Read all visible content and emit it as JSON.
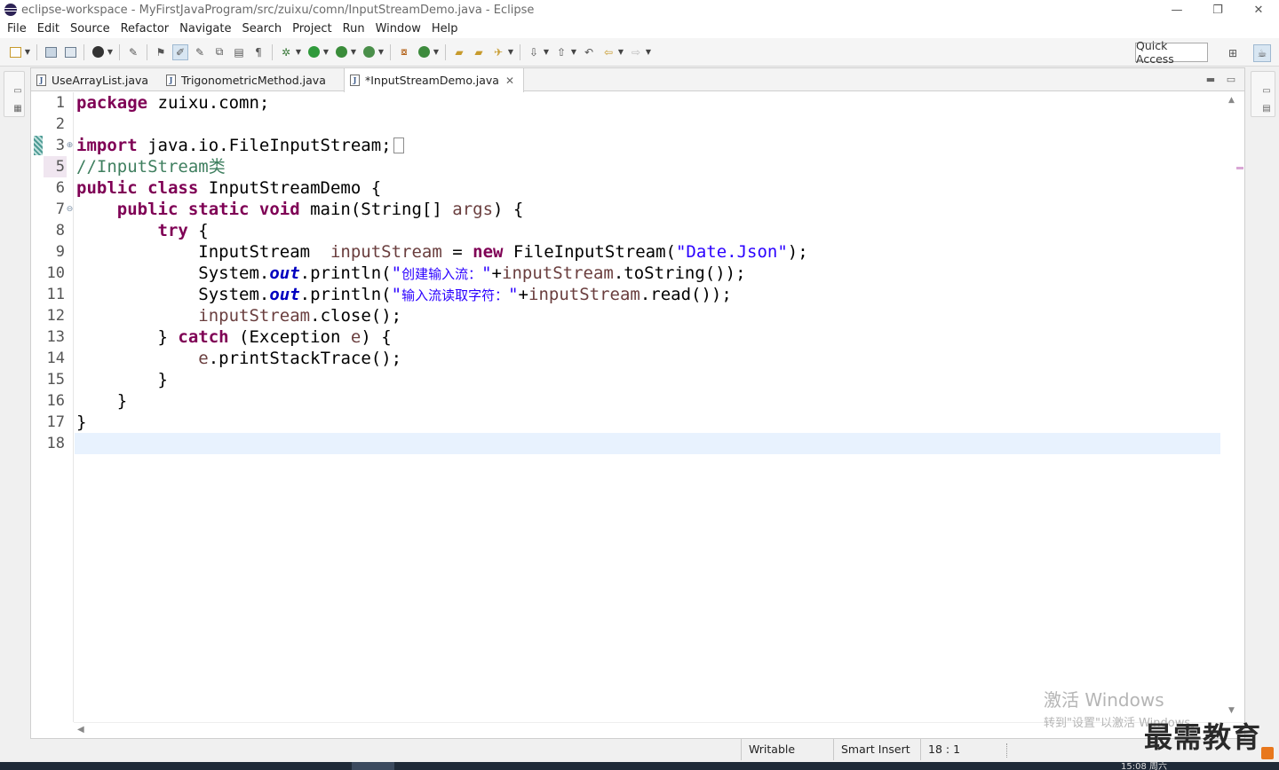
{
  "window": {
    "title": "eclipse-workspace - MyFirstJavaProgram/src/zuixu/comn/InputStreamDemo.java - Eclipse",
    "minimize": "—",
    "restore": "❐",
    "close": "✕"
  },
  "menu": [
    "File",
    "Edit",
    "Source",
    "Refactor",
    "Navigate",
    "Search",
    "Project",
    "Run",
    "Window",
    "Help"
  ],
  "toolbar": {
    "quick_access": "Quick Access"
  },
  "tabs": [
    {
      "label": "UseArrayList.java",
      "active": false
    },
    {
      "label": "TrigonometricMethod.java",
      "active": false
    },
    {
      "label": "*InputStreamDemo.java",
      "active": true,
      "close": "✕"
    }
  ],
  "editor": {
    "line_numbers": [
      "1",
      "2",
      "3",
      "5",
      "6",
      "7",
      "8",
      "9",
      "10",
      "11",
      "12",
      "13",
      "14",
      "15",
      "16",
      "17",
      "18"
    ],
    "code": {
      "l1_kw": "package",
      "l1_rest": " zuixu.comn;",
      "l3_kw": "import",
      "l3_rest": " java.io.FileInputStream;",
      "l5_comment": "//InputStream类",
      "l6_kw": "public class",
      "l6_rest": " InputStreamDemo {",
      "l7_indent": "    ",
      "l7_kw": "public static void",
      "l7_mid": " main(String[] ",
      "l7_arg": "args",
      "l7_end": ") {",
      "l8_indent": "        ",
      "l8_kw": "try",
      "l8_end": " {",
      "l9_a": "            InputStream  ",
      "l9_var": "inputStream",
      "l9_b": " = ",
      "l9_kw": "new",
      "l9_c": " FileInputStream(",
      "l9_str": "\"Date.Json\"",
      "l9_d": ");",
      "l10_a": "            System.",
      "l10_fld": "out",
      "l10_b": ".println(",
      "l10_q1": "\"",
      "l10_cn": "创建输入流：",
      "l10_q2": "\"",
      "l10_c": "+",
      "l10_var": "inputStream",
      "l10_d": ".toString());",
      "l11_a": "            System.",
      "l11_fld": "out",
      "l11_b": ".println(",
      "l11_q1": "\"",
      "l11_cn": "输入流读取字符：",
      "l11_q2": "\"",
      "l11_c": "+",
      "l11_var": "inputStream",
      "l11_d": ".read());",
      "l12_indent": "            ",
      "l12_var": "inputStream",
      "l12_d": ".close();",
      "l13_a": "        } ",
      "l13_kw": "catch",
      "l13_b": " (Exception ",
      "l13_var": "e",
      "l13_c": ") {",
      "l14_a": "            ",
      "l14_var": "e",
      "l14_b": ".printStackTrace();",
      "l15": "        }",
      "l16": "    }",
      "l17": "}"
    }
  },
  "status": {
    "writable": "Writable",
    "insert_mode": "Smart Insert",
    "cursor_position": "18 : 1"
  },
  "watermark": {
    "activate_line1": "激活 Windows",
    "activate_line2": "转到\"设置\"以激活 Windows。",
    "brand": "最需教育",
    "clock": "15:08 周六"
  }
}
